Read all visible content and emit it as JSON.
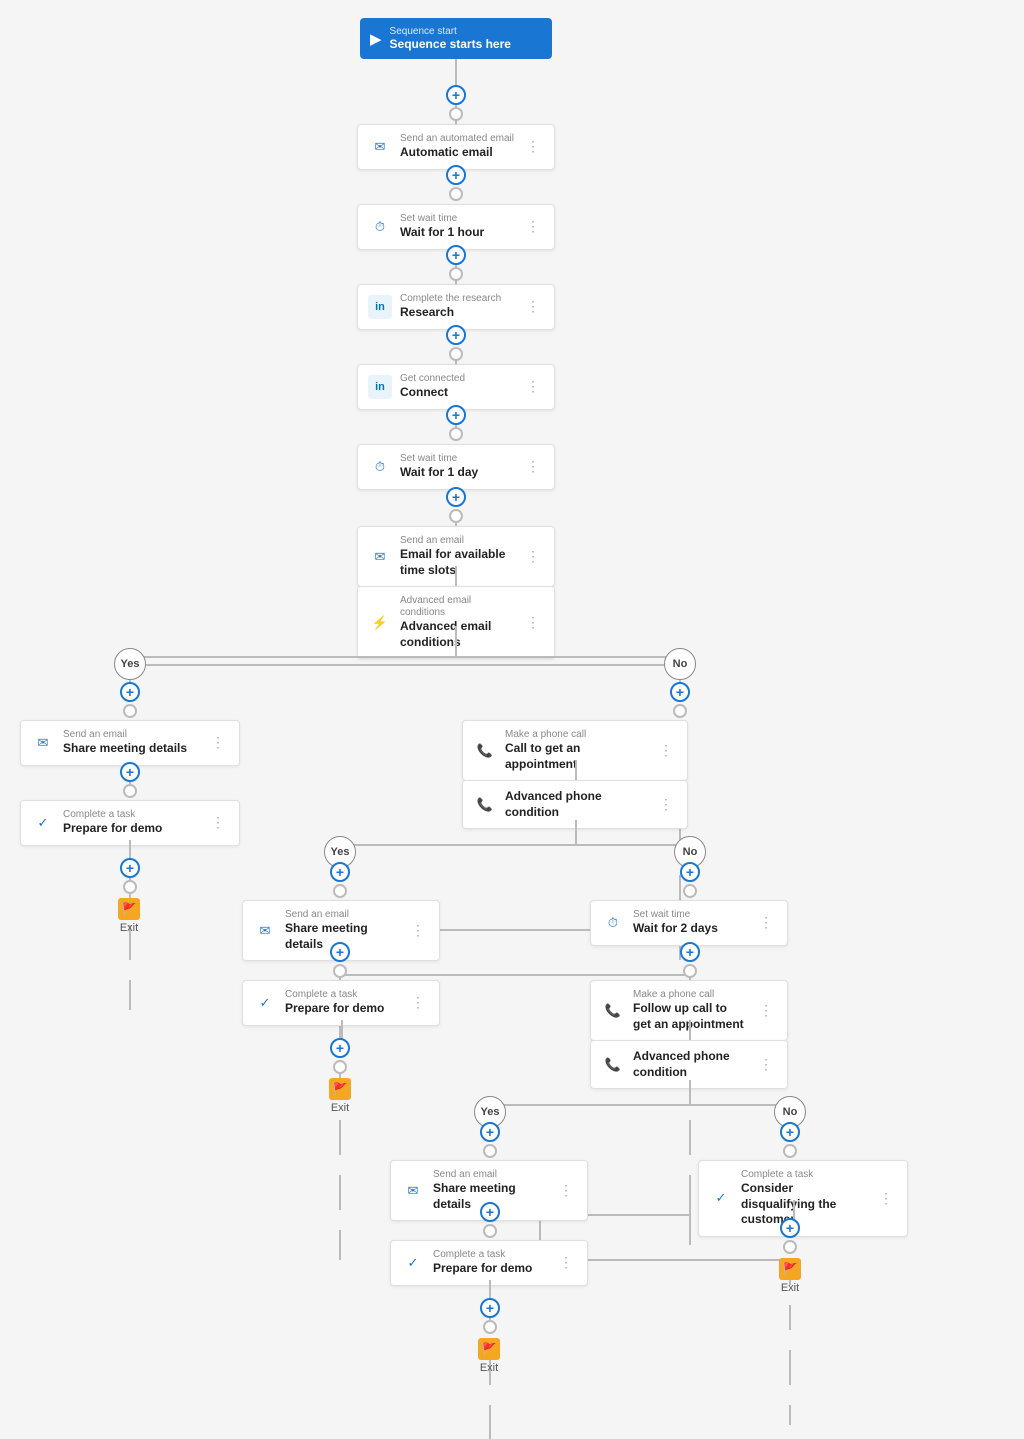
{
  "nodes": {
    "sequence_start": {
      "label": "Sequence start",
      "title": "Sequence starts here"
    },
    "automatic_email": {
      "label": "Send an automated email",
      "title": "Automatic email"
    },
    "wait_1hour": {
      "label": "Set wait time",
      "title": "Wait for 1 hour"
    },
    "research": {
      "label": "Complete the research",
      "title": "Research"
    },
    "connect": {
      "label": "Get connected",
      "title": "Connect"
    },
    "wait_1day": {
      "label": "Set wait time",
      "title": "Wait for 1 day"
    },
    "email_timeslots": {
      "label": "Send an email",
      "title": "Email for available time slots"
    },
    "advanced_email": {
      "label": "Advanced email conditions",
      "title": "Advanced email conditions"
    },
    "yes_label": "Yes",
    "no_label": "No",
    "share_meeting_yes": {
      "label": "Send an email",
      "title": "Share meeting details"
    },
    "prepare_demo_yes": {
      "label": "Complete a task",
      "title": "Prepare for demo"
    },
    "exit_1": "Exit",
    "call_appointment": {
      "label": "Make a phone call",
      "title": "Call to get an appointment"
    },
    "advanced_phone_1": {
      "label": "",
      "title": "Advanced phone condition"
    },
    "yes2_label": "Yes",
    "no2_label": "No",
    "share_meeting_yes2": {
      "label": "Send an email",
      "title": "Share meeting details"
    },
    "prepare_demo_yes2": {
      "label": "Complete a task",
      "title": "Prepare for demo"
    },
    "exit_2": "Exit",
    "wait_2days": {
      "label": "Set wait time",
      "title": "Wait for 2 days"
    },
    "followup_call": {
      "label": "Make a phone call",
      "title": "Follow up call to get an appointment"
    },
    "advanced_phone_2": {
      "label": "",
      "title": "Advanced phone condition"
    },
    "yes3_label": "Yes",
    "no3_label": "No",
    "share_meeting_yes3": {
      "label": "Send an email",
      "title": "Share meeting details"
    },
    "disqualify": {
      "label": "Complete a task",
      "title": "Consider disqualifying the customer"
    },
    "prepare_demo_yes3": {
      "label": "Complete a task",
      "title": "Prepare for demo"
    },
    "exit_3": "Exit",
    "exit_4": "Exit"
  },
  "icons": {
    "start": "▶",
    "email": "✉",
    "clock": "⏱",
    "linkedin": "in",
    "phone": "📞",
    "task": "✓",
    "condition": "⚡",
    "exit": "🚩",
    "menu": "⋮",
    "plus": "+"
  },
  "colors": {
    "blue_primary": "#1976d2",
    "card_border": "#e0e0e0",
    "connector": "#aaa",
    "branch_yes": "#fff",
    "branch_no": "#fff",
    "exit_orange": "#f5a623"
  }
}
